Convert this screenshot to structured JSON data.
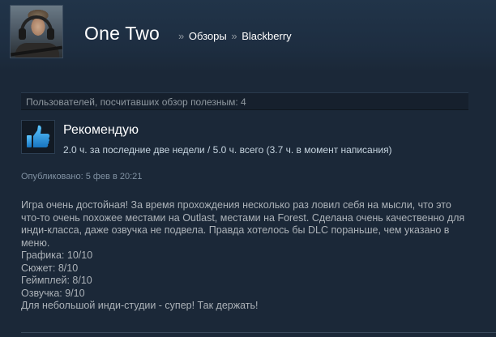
{
  "profile": {
    "username": "One Two",
    "avatar_icon": "user-avatar-icon"
  },
  "breadcrumb": {
    "sep1": "»",
    "reviews": "Обзоры",
    "sep2": "»",
    "game": "Blackberry"
  },
  "review": {
    "helpful_text": "Пользователей, посчитавших обзор полезным: 4",
    "verdict": "Рекомендую",
    "verdict_icon": "thumbs-up-icon",
    "hours": "2.0 ч. за последние две недели / 5.0 ч. всего (3.7 ч. в момент написания)",
    "posted": "Опубликовано: 5 фев в 20:21",
    "body_lines": [
      "Игра очень достойная! За время прохождения несколько раз ловил себя на мысли, что это",
      "что-то очень похожее местами на Outlast, местами на Forest. Сделана очень качественно для",
      "инди-класса, даже озвучка не подвела. Правда хотелось бы DLC пораньше, чем указано в",
      "меню.",
      "Графика: 10/10",
      "Сюжет: 8/10",
      "Геймплей: 8/10",
      "Озвучка: 9/10",
      "Для небольшой инди-студии - супер! Так держать!"
    ]
  },
  "colors": {
    "background": "#1b2838",
    "accent": "#66c0f4",
    "thumb": "#1b8fd2"
  }
}
